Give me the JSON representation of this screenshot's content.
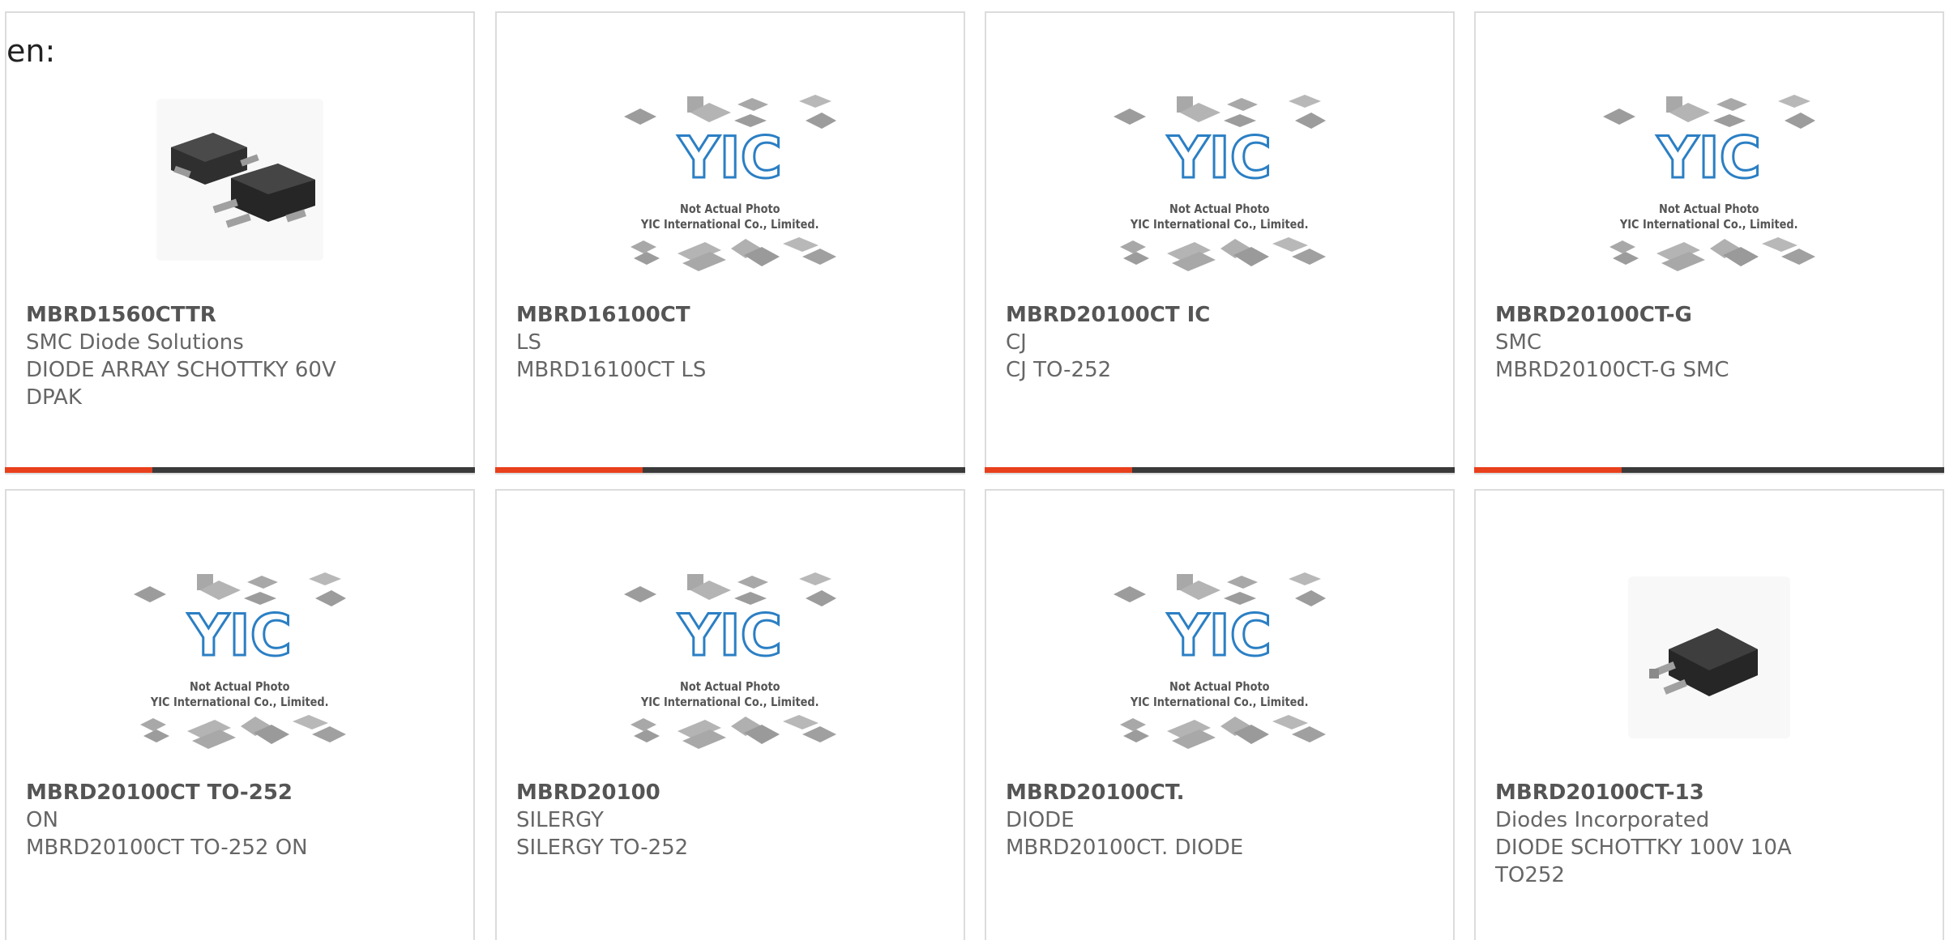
{
  "page": {
    "prefix_text": "en:",
    "accent_color": "#e8401c",
    "bar_color": "#3a3a3a"
  },
  "placeholder": {
    "logo_text": "YIC",
    "line1": "Not Actual Photo",
    "line2": "YIC International Co., Limited."
  },
  "products": [
    {
      "name": "MBRD1560CTTR",
      "manufacturer": "SMC Diode Solutions",
      "description": "DIODE ARRAY SCHOTTKY 60V DPAK",
      "image": "dpak-pair-photo"
    },
    {
      "name": "MBRD16100CT",
      "manufacturer": "LS",
      "description": "MBRD16100CT LS",
      "image": "yic-placeholder"
    },
    {
      "name": "MBRD20100CT IC",
      "manufacturer": "CJ",
      "description": "CJ TO-252",
      "image": "yic-placeholder"
    },
    {
      "name": "MBRD20100CT-G",
      "manufacturer": "SMC",
      "description": "MBRD20100CT-G SMC",
      "image": "yic-placeholder"
    },
    {
      "name": "MBRD20100CT TO-252",
      "manufacturer": "ON",
      "description": "MBRD20100CT TO-252 ON",
      "image": "yic-placeholder"
    },
    {
      "name": "MBRD20100",
      "manufacturer": "SILERGY",
      "description": "SILERGY TO-252",
      "image": "yic-placeholder"
    },
    {
      "name": "MBRD20100CT.",
      "manufacturer": "DIODE",
      "description": "MBRD20100CT. DIODE",
      "image": "yic-placeholder"
    },
    {
      "name": "MBRD20100CT-13",
      "manufacturer": "Diodes Incorporated",
      "description": "DIODE SCHOTTKY 100V 10A TO252",
      "image": "to252-single-photo"
    }
  ]
}
